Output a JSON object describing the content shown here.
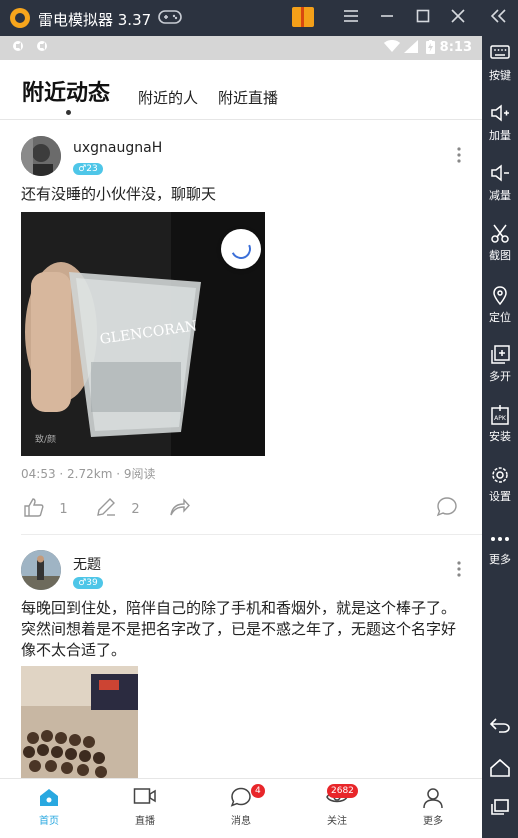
{
  "emulator": {
    "title": "雷电模拟器 3.37",
    "colors": {
      "chrome": "#2c3340",
      "gift": "#f4a019"
    },
    "sidebar": [
      {
        "icon": "keyboard-icon",
        "label": "按键"
      },
      {
        "icon": "volume-up-icon",
        "label": "加量"
      },
      {
        "icon": "volume-down-icon",
        "label": "减量"
      },
      {
        "icon": "scissors-icon",
        "label": "截图"
      },
      {
        "icon": "location-pin-icon",
        "label": "定位"
      },
      {
        "icon": "multi-window-icon",
        "label": "多开"
      },
      {
        "icon": "apk-install-icon",
        "label": "安装"
      },
      {
        "icon": "gear-icon",
        "label": "设置"
      },
      {
        "icon": "more-dots-icon",
        "label": "更多"
      }
    ]
  },
  "statusbar": {
    "time": "8:13"
  },
  "tabs": {
    "active": "附近动态",
    "others": [
      "附近的人",
      "附近直播"
    ]
  },
  "posts": [
    {
      "username": "uxgnaugnaH",
      "gender_age": "♂23",
      "text": "还有没睡的小伙伴没，聊聊天",
      "image_caption": "GLENCORAN",
      "meta": "04:53 · 2.72km · 9阅读",
      "likes": "1",
      "comments": "2"
    },
    {
      "username": "无题",
      "gender_age": "♂39",
      "text": "每晚回到住处，陪伴自己的除了手机和香烟外，就是这个棒子了。突然间想着是不是把名字改了，已是不惑之年了，无题这个名字好像不太合适了。"
    }
  ],
  "bottomnav": {
    "items": [
      {
        "label": "首页",
        "icon": "home-icon",
        "active": true
      },
      {
        "label": "直播",
        "icon": "video-camera-icon"
      },
      {
        "label": "消息",
        "icon": "chat-bubble-icon",
        "badge": "4"
      },
      {
        "label": "关注",
        "icon": "eye-icon",
        "badge": "2682"
      },
      {
        "label": "更多",
        "icon": "person-icon"
      }
    ],
    "accent": "#29a8e0",
    "badge_color": "#e8262a"
  }
}
